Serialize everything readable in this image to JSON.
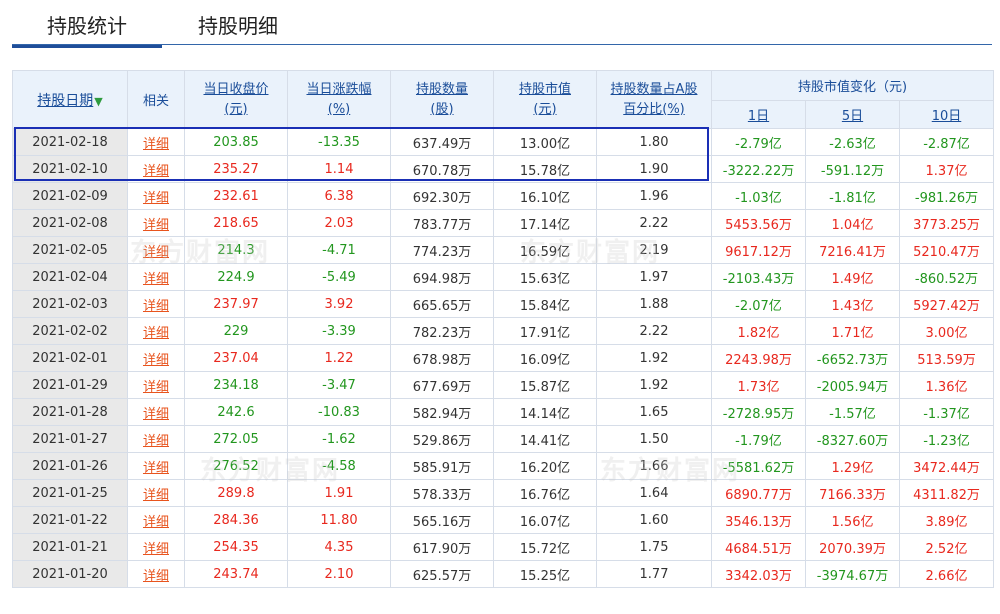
{
  "tabs": [
    {
      "label": "持股统计",
      "active": true
    },
    {
      "label": "持股明细",
      "active": false
    }
  ],
  "headers": {
    "date": "持股日期",
    "related": "相关",
    "close_price": [
      "当日收盘价",
      "(元)"
    ],
    "change_pct": [
      "当日涨跌幅",
      "(%)"
    ],
    "hold_qty": [
      "持股数量",
      "(股)"
    ],
    "hold_value": [
      "持股市值",
      "(元)"
    ],
    "hold_pct": [
      "持股数量占A股",
      "百分比(%)"
    ],
    "value_change": "持股市值变化（元)",
    "periods": [
      "1日",
      "5日",
      "10日"
    ]
  },
  "detail_label": "详细",
  "watermark": "东方财富网",
  "rows": [
    {
      "date": "2021-02-18",
      "price": "203.85",
      "chg": "-13.35",
      "qty": "637.49万",
      "value": "13.00亿",
      "pct": "1.80",
      "d1": "-2.79亿",
      "d5": "-2.63亿",
      "d10": "-2.87亿"
    },
    {
      "date": "2021-02-10",
      "price": "235.27",
      "chg": "1.14",
      "qty": "670.78万",
      "value": "15.78亿",
      "pct": "1.90",
      "d1": "-3222.22万",
      "d5": "-591.12万",
      "d10": "1.37亿"
    },
    {
      "date": "2021-02-09",
      "price": "232.61",
      "chg": "6.38",
      "qty": "692.30万",
      "value": "16.10亿",
      "pct": "1.96",
      "d1": "-1.03亿",
      "d5": "-1.81亿",
      "d10": "-981.26万"
    },
    {
      "date": "2021-02-08",
      "price": "218.65",
      "chg": "2.03",
      "qty": "783.77万",
      "value": "17.14亿",
      "pct": "2.22",
      "d1": "5453.56万",
      "d5": "1.04亿",
      "d10": "3773.25万"
    },
    {
      "date": "2021-02-05",
      "price": "214.3",
      "chg": "-4.71",
      "qty": "774.23万",
      "value": "16.59亿",
      "pct": "2.19",
      "d1": "9617.12万",
      "d5": "7216.41万",
      "d10": "5210.47万"
    },
    {
      "date": "2021-02-04",
      "price": "224.9",
      "chg": "-5.49",
      "qty": "694.98万",
      "value": "15.63亿",
      "pct": "1.97",
      "d1": "-2103.43万",
      "d5": "1.49亿",
      "d10": "-860.52万"
    },
    {
      "date": "2021-02-03",
      "price": "237.97",
      "chg": "3.92",
      "qty": "665.65万",
      "value": "15.84亿",
      "pct": "1.88",
      "d1": "-2.07亿",
      "d5": "1.43亿",
      "d10": "5927.42万"
    },
    {
      "date": "2021-02-02",
      "price": "229",
      "chg": "-3.39",
      "qty": "782.23万",
      "value": "17.91亿",
      "pct": "2.22",
      "d1": "1.82亿",
      "d5": "1.71亿",
      "d10": "3.00亿"
    },
    {
      "date": "2021-02-01",
      "price": "237.04",
      "chg": "1.22",
      "qty": "678.98万",
      "value": "16.09亿",
      "pct": "1.92",
      "d1": "2243.98万",
      "d5": "-6652.73万",
      "d10": "513.59万"
    },
    {
      "date": "2021-01-29",
      "price": "234.18",
      "chg": "-3.47",
      "qty": "677.69万",
      "value": "15.87亿",
      "pct": "1.92",
      "d1": "1.73亿",
      "d5": "-2005.94万",
      "d10": "1.36亿"
    },
    {
      "date": "2021-01-28",
      "price": "242.6",
      "chg": "-10.83",
      "qty": "582.94万",
      "value": "14.14亿",
      "pct": "1.65",
      "d1": "-2728.95万",
      "d5": "-1.57亿",
      "d10": "-1.37亿"
    },
    {
      "date": "2021-01-27",
      "price": "272.05",
      "chg": "-1.62",
      "qty": "529.86万",
      "value": "14.41亿",
      "pct": "1.50",
      "d1": "-1.79亿",
      "d5": "-8327.60万",
      "d10": "-1.23亿"
    },
    {
      "date": "2021-01-26",
      "price": "276.52",
      "chg": "-4.58",
      "qty": "585.91万",
      "value": "16.20亿",
      "pct": "1.66",
      "d1": "-5581.62万",
      "d5": "1.29亿",
      "d10": "3472.44万"
    },
    {
      "date": "2021-01-25",
      "price": "289.8",
      "chg": "1.91",
      "qty": "578.33万",
      "value": "16.76亿",
      "pct": "1.64",
      "d1": "6890.77万",
      "d5": "7166.33万",
      "d10": "4311.82万"
    },
    {
      "date": "2021-01-22",
      "price": "284.36",
      "chg": "11.80",
      "qty": "565.16万",
      "value": "16.07亿",
      "pct": "1.60",
      "d1": "3546.13万",
      "d5": "1.56亿",
      "d10": "3.89亿"
    },
    {
      "date": "2021-01-21",
      "price": "254.35",
      "chg": "4.35",
      "qty": "617.90万",
      "value": "15.72亿",
      "pct": "1.75",
      "d1": "4684.51万",
      "d5": "2070.39万",
      "d10": "2.52亿"
    },
    {
      "date": "2021-01-20",
      "price": "243.74",
      "chg": "2.10",
      "qty": "625.57万",
      "value": "15.25亿",
      "pct": "1.77",
      "d1": "3342.03万",
      "d5": "-3974.67万",
      "d10": "2.66亿"
    }
  ]
}
